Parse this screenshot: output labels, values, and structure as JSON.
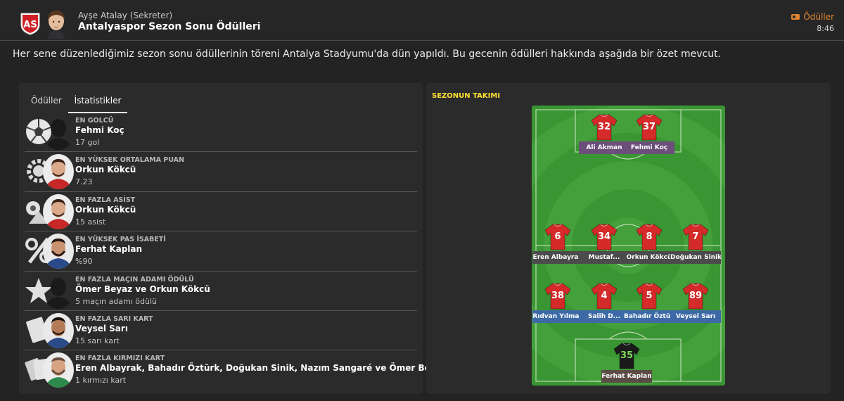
{
  "header": {
    "sender_name": "Ayşe Atalay",
    "sender_role": "(Sekreter)",
    "subject": "Antalyaspor Sezon Sonu Ödülleri",
    "tag_label": "Ödüller",
    "time": "8:46"
  },
  "intro": "Her sene düzenlediğimiz sezon sonu ödüllerinin töreni Antalya Stadyumu'da dün yapıldı. Bu gecenin ödülleri hakkında aşağıda bir özet mevcut.",
  "tabs": [
    {
      "label": "Ödüller",
      "active": false
    },
    {
      "label": "İstatistikler",
      "active": true
    }
  ],
  "awards": [
    {
      "category": "EN GOLCÜ",
      "player": "Fehmi Koç",
      "value": "17 gol",
      "icon": "football-icon"
    },
    {
      "category": "EN YÜKSEK ORTALAMA PUAN",
      "player": "Orkun Kökcü",
      "value": "7.23",
      "icon": "gear-badge-icon"
    },
    {
      "category": "EN FAZLA ASİST",
      "player": "Orkun Kökcü",
      "value": "15 asist",
      "icon": "assist-icon"
    },
    {
      "category": "EN YÜKSEK PAS İSABETİ",
      "player": "Ferhat Kaplan",
      "value": "%90",
      "icon": "percent-icon"
    },
    {
      "category": "EN FAZLA MAÇIN ADAMI ÖDÜLÜ",
      "player": "Ömer Beyaz ve Orkun Kökcü",
      "value": "5 maçın adamı ödülü",
      "icon": "star-icon"
    },
    {
      "category": "EN FAZLA SARI KART",
      "player": "Veysel Sarı",
      "value": "15 sarı kart",
      "icon": "yellow-card-icon"
    },
    {
      "category": "EN FAZLA KIRMIZI KART",
      "player": "Eren Albayrak, Bahadır Öztürk, Doğukan Sinik, Nazım Sangaré ve Ömer Beyaz",
      "value": "1 kırmızı kart",
      "icon": "red-card-icon"
    }
  ],
  "team_of_season": {
    "title": "SEZONUN TAKIMI",
    "players": [
      {
        "number": "32",
        "name": "Ali Akman"
      },
      {
        "number": "37",
        "name": "Fehmi Koç"
      },
      {
        "number": "6",
        "name": "Eren Albayrak"
      },
      {
        "number": "34",
        "name": "Mustaf..."
      },
      {
        "number": "8",
        "name": "Orkun Kökcü"
      },
      {
        "number": "7",
        "name": "Doğukan Sinik"
      },
      {
        "number": "38",
        "name": "Rıdvan Yılmaz"
      },
      {
        "number": "4",
        "name": "Salih D..."
      },
      {
        "number": "5",
        "name": "Bahadır Öztürk"
      },
      {
        "number": "89",
        "name": "Veysel Sarı"
      },
      {
        "number": "35",
        "name": "Ferhat Kaplan"
      }
    ]
  },
  "colors": {
    "accent": "#e0862f",
    "section_title": "#ffe033",
    "pitch_green": "#3e9a35",
    "shirt_red": "#d42a2a",
    "keeper_shirt": "#1a1a1a",
    "keeper_number": "#7cd957",
    "forward_label": "#6b4e79",
    "midfield_label": "#4b4b4b",
    "defender_label": "#3d6aa6",
    "keeper_label": "#5b4b45"
  }
}
